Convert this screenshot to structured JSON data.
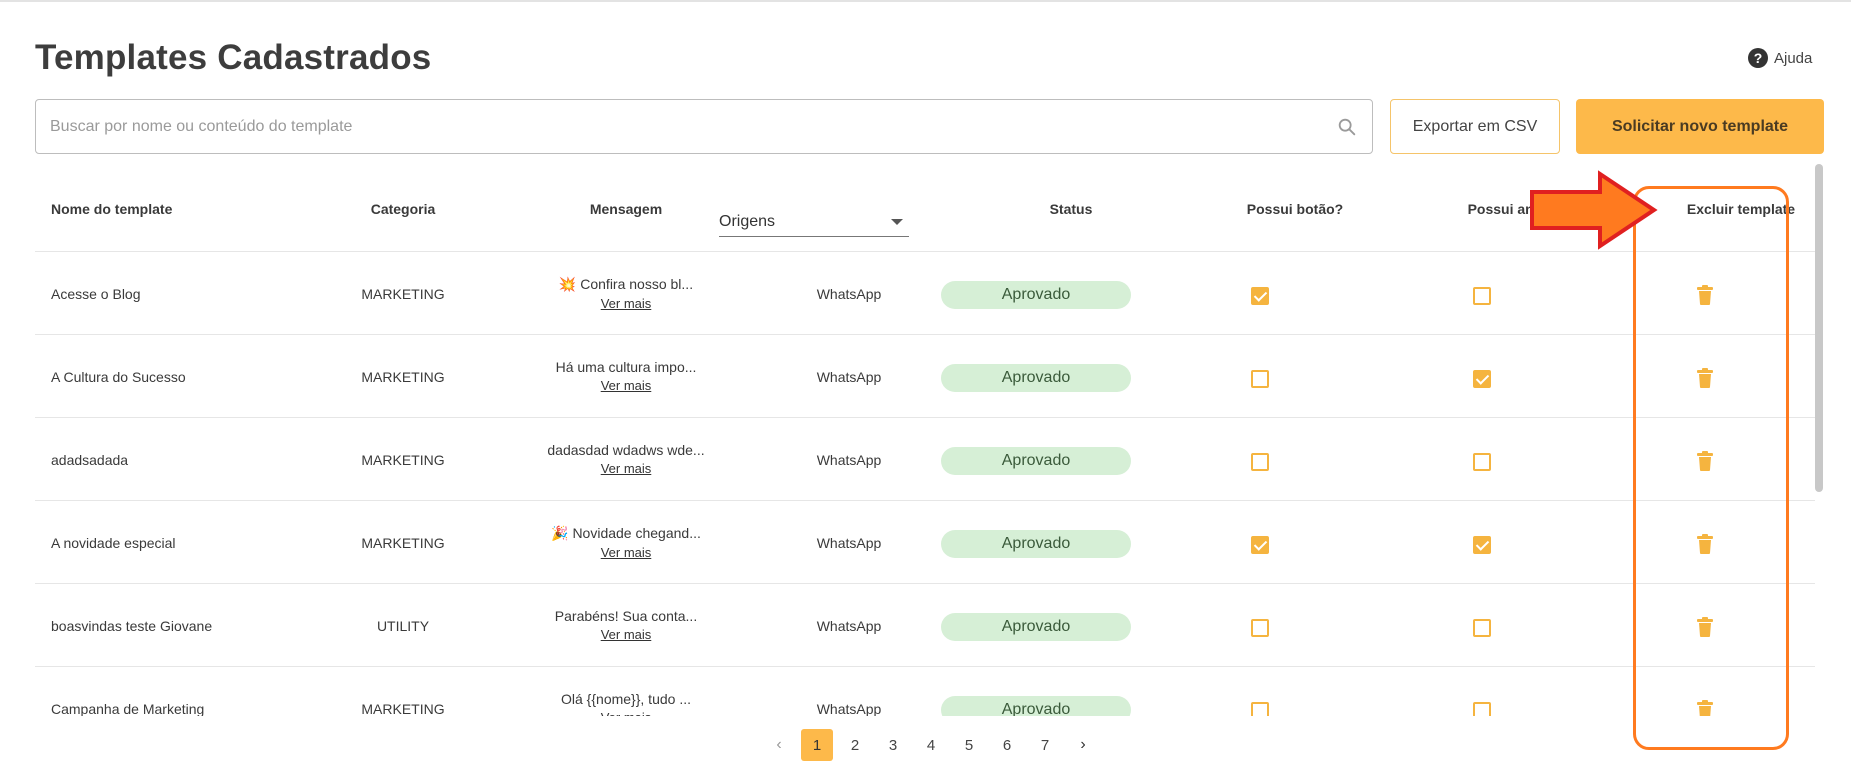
{
  "page": {
    "title": "Templates Cadastrados",
    "help_label": "Ajuda"
  },
  "search": {
    "placeholder": "Buscar por nome ou conteúdo do template",
    "value": ""
  },
  "actions": {
    "export_label": "Exportar em CSV",
    "new_label": "Solicitar novo template"
  },
  "table": {
    "headers": {
      "name": "Nome do template",
      "category": "Categoria",
      "message": "Mensagem",
      "origins": "Origens",
      "status": "Status",
      "has_button": "Possui botão?",
      "has_attachment": "Possui anexo?",
      "delete": "Excluir template"
    },
    "see_more": "Ver mais",
    "rows": [
      {
        "name": "Acesse o Blog",
        "category": "MARKETING",
        "message": "💥 Confira nosso bl...",
        "origin": "WhatsApp",
        "status": "Aprovado",
        "has_button": true,
        "has_attachment": false
      },
      {
        "name": "A Cultura do Sucesso",
        "category": "MARKETING",
        "message": "Há uma cultura impo...",
        "origin": "WhatsApp",
        "status": "Aprovado",
        "has_button": false,
        "has_attachment": true
      },
      {
        "name": "adadsadada",
        "category": "MARKETING",
        "message": "dadasdad wdadws wde...",
        "origin": "WhatsApp",
        "status": "Aprovado",
        "has_button": false,
        "has_attachment": false
      },
      {
        "name": "A novidade especial",
        "category": "MARKETING",
        "message": "🎉 Novidade chegand...",
        "origin": "WhatsApp",
        "status": "Aprovado",
        "has_button": true,
        "has_attachment": true
      },
      {
        "name": "boasvindas teste Giovane",
        "category": "UTILITY",
        "message": "Parabéns! Sua conta...",
        "origin": "WhatsApp",
        "status": "Aprovado",
        "has_button": false,
        "has_attachment": false
      },
      {
        "name": "Campanha de Marketing",
        "category": "MARKETING",
        "message": "Olá {{nome}}, tudo ...",
        "origin": "WhatsApp",
        "status": "Aprovado",
        "has_button": false,
        "has_attachment": false
      }
    ]
  },
  "pagination": {
    "pages": [
      "1",
      "2",
      "3",
      "4",
      "5",
      "6",
      "7"
    ],
    "current": "1"
  },
  "colors": {
    "accent": "#fdb94a",
    "checkbox": "#f5b43f",
    "status_bg": "#d6efd6",
    "annotation": "#ff7a1f",
    "arrow_fill": "#ff7a1f",
    "arrow_stroke": "#e02020"
  },
  "icons": {
    "search": "search-icon",
    "help": "help-circle-icon",
    "delete": "trash-icon",
    "prev": "chevron-left-icon",
    "next": "chevron-right-icon",
    "dropdown": "caret-down-icon"
  }
}
